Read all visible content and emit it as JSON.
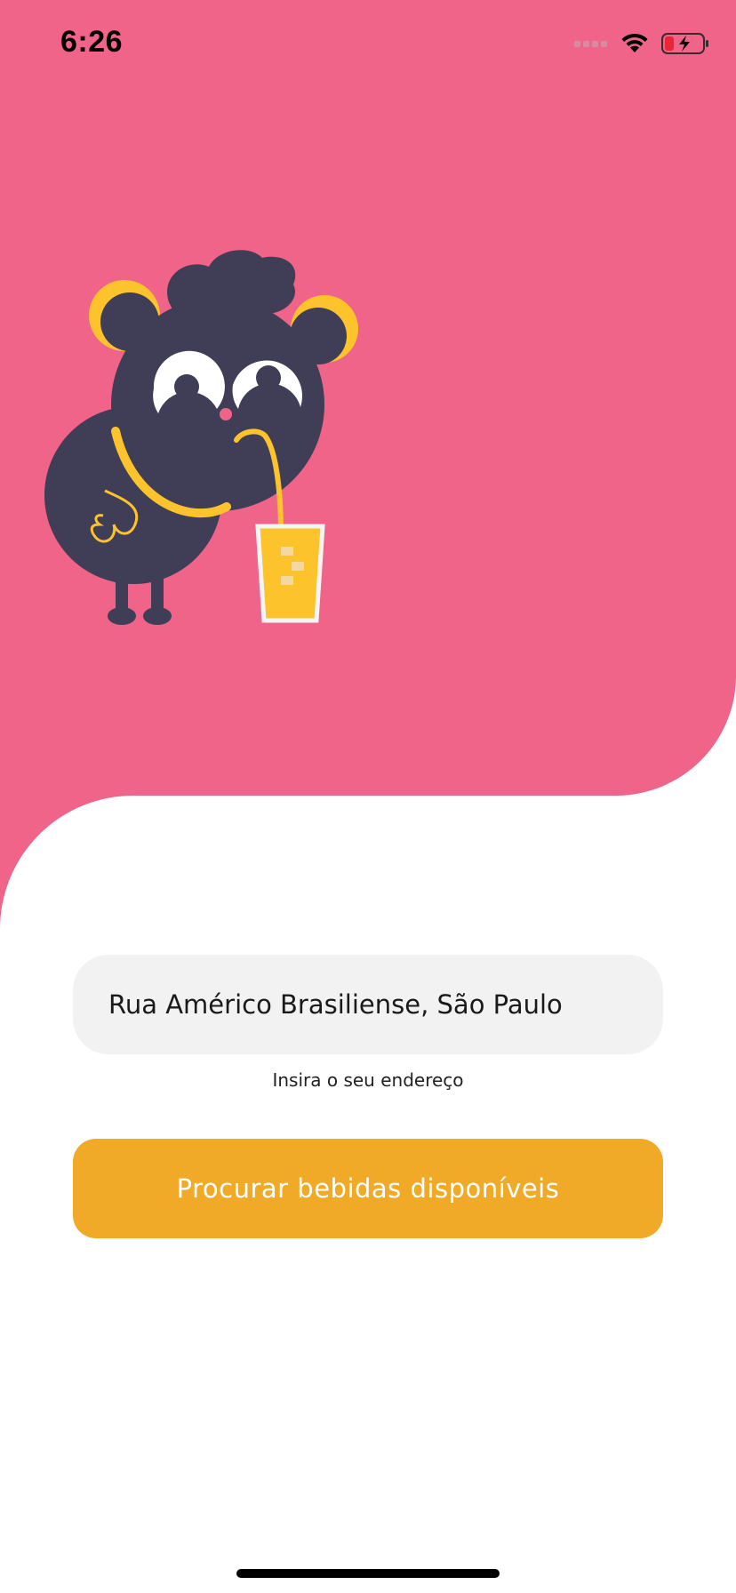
{
  "status_bar": {
    "time": "6:26",
    "icons": [
      "signal-icon",
      "wifi-icon",
      "battery-charging-icon"
    ]
  },
  "colors": {
    "hero_background": "#f06489",
    "mascot_body": "#403d56",
    "mascot_accent": "#fcc32c",
    "button_background": "#f0aa28",
    "field_background": "#f2f2f2"
  },
  "illustration": {
    "description_icon": "mascot-drinking-juice-icon"
  },
  "address": {
    "value": "Rua Américo Brasiliense, São Paulo",
    "hint": "Insira o seu endereço"
  },
  "search_button": {
    "label": "Procurar bebidas disponíveis"
  }
}
